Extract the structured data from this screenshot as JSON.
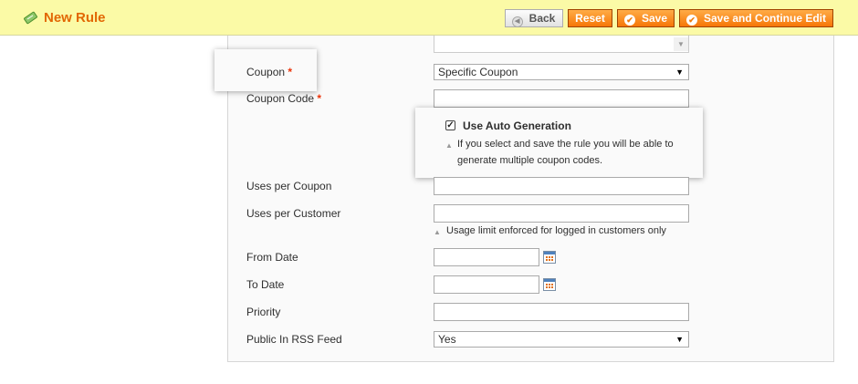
{
  "header": {
    "title": "New Rule",
    "title_icon": "ticket-icon",
    "accent_color": "#e26703",
    "background_color": "#fbfaa6"
  },
  "toolbar": {
    "back_label": "Back",
    "reset_label": "Reset",
    "save_label": "Save",
    "save_continue_label": "Save and Continue Edit"
  },
  "form": {
    "coupon_label": "Coupon",
    "coupon_required": "*",
    "coupon_value": "Specific Coupon",
    "coupon_code_label": "Coupon Code",
    "coupon_code_required": "*",
    "coupon_code_value": "",
    "auto_generation_label": "Use Auto Generation",
    "auto_generation_checked": true,
    "auto_generation_hint_line1": "If you select and save the rule you will be able to",
    "auto_generation_hint_line2": "generate multiple coupon codes.",
    "uses_per_coupon_label": "Uses per Coupon",
    "uses_per_coupon_value": "",
    "uses_per_customer_label": "Uses per Customer",
    "uses_per_customer_value": "",
    "uses_per_customer_hint": "Usage limit enforced for logged in customers only",
    "from_date_label": "From Date",
    "from_date_value": "",
    "to_date_label": "To Date",
    "to_date_value": "",
    "priority_label": "Priority",
    "priority_value": "",
    "rss_label": "Public In RSS Feed",
    "rss_value": "Yes"
  }
}
